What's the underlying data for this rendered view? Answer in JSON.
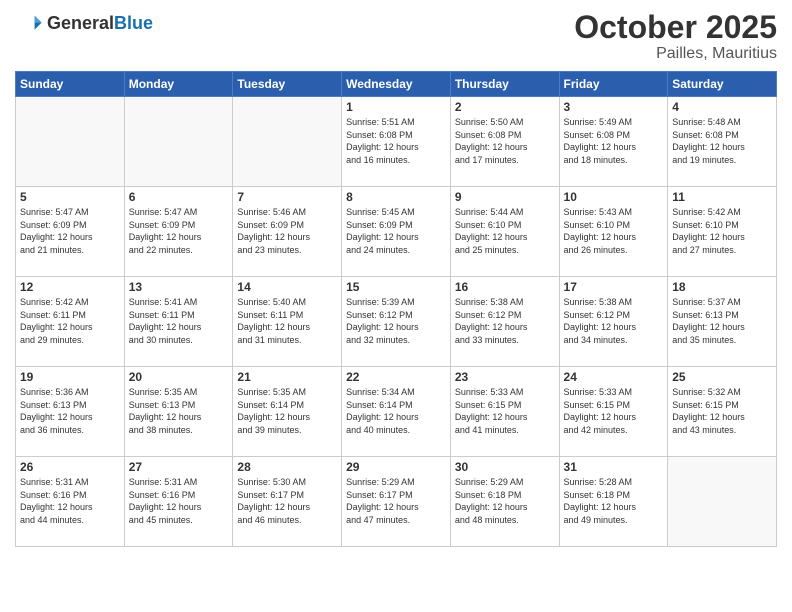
{
  "header": {
    "logo_general": "General",
    "logo_blue": "Blue",
    "month": "October 2025",
    "location": "Pailles, Mauritius"
  },
  "weekdays": [
    "Sunday",
    "Monday",
    "Tuesday",
    "Wednesday",
    "Thursday",
    "Friday",
    "Saturday"
  ],
  "weeks": [
    [
      {
        "day": "",
        "info": ""
      },
      {
        "day": "",
        "info": ""
      },
      {
        "day": "",
        "info": ""
      },
      {
        "day": "1",
        "info": "Sunrise: 5:51 AM\nSunset: 6:08 PM\nDaylight: 12 hours\nand 16 minutes."
      },
      {
        "day": "2",
        "info": "Sunrise: 5:50 AM\nSunset: 6:08 PM\nDaylight: 12 hours\nand 17 minutes."
      },
      {
        "day": "3",
        "info": "Sunrise: 5:49 AM\nSunset: 6:08 PM\nDaylight: 12 hours\nand 18 minutes."
      },
      {
        "day": "4",
        "info": "Sunrise: 5:48 AM\nSunset: 6:08 PM\nDaylight: 12 hours\nand 19 minutes."
      }
    ],
    [
      {
        "day": "5",
        "info": "Sunrise: 5:47 AM\nSunset: 6:09 PM\nDaylight: 12 hours\nand 21 minutes."
      },
      {
        "day": "6",
        "info": "Sunrise: 5:47 AM\nSunset: 6:09 PM\nDaylight: 12 hours\nand 22 minutes."
      },
      {
        "day": "7",
        "info": "Sunrise: 5:46 AM\nSunset: 6:09 PM\nDaylight: 12 hours\nand 23 minutes."
      },
      {
        "day": "8",
        "info": "Sunrise: 5:45 AM\nSunset: 6:09 PM\nDaylight: 12 hours\nand 24 minutes."
      },
      {
        "day": "9",
        "info": "Sunrise: 5:44 AM\nSunset: 6:10 PM\nDaylight: 12 hours\nand 25 minutes."
      },
      {
        "day": "10",
        "info": "Sunrise: 5:43 AM\nSunset: 6:10 PM\nDaylight: 12 hours\nand 26 minutes."
      },
      {
        "day": "11",
        "info": "Sunrise: 5:42 AM\nSunset: 6:10 PM\nDaylight: 12 hours\nand 27 minutes."
      }
    ],
    [
      {
        "day": "12",
        "info": "Sunrise: 5:42 AM\nSunset: 6:11 PM\nDaylight: 12 hours\nand 29 minutes."
      },
      {
        "day": "13",
        "info": "Sunrise: 5:41 AM\nSunset: 6:11 PM\nDaylight: 12 hours\nand 30 minutes."
      },
      {
        "day": "14",
        "info": "Sunrise: 5:40 AM\nSunset: 6:11 PM\nDaylight: 12 hours\nand 31 minutes."
      },
      {
        "day": "15",
        "info": "Sunrise: 5:39 AM\nSunset: 6:12 PM\nDaylight: 12 hours\nand 32 minutes."
      },
      {
        "day": "16",
        "info": "Sunrise: 5:38 AM\nSunset: 6:12 PM\nDaylight: 12 hours\nand 33 minutes."
      },
      {
        "day": "17",
        "info": "Sunrise: 5:38 AM\nSunset: 6:12 PM\nDaylight: 12 hours\nand 34 minutes."
      },
      {
        "day": "18",
        "info": "Sunrise: 5:37 AM\nSunset: 6:13 PM\nDaylight: 12 hours\nand 35 minutes."
      }
    ],
    [
      {
        "day": "19",
        "info": "Sunrise: 5:36 AM\nSunset: 6:13 PM\nDaylight: 12 hours\nand 36 minutes."
      },
      {
        "day": "20",
        "info": "Sunrise: 5:35 AM\nSunset: 6:13 PM\nDaylight: 12 hours\nand 38 minutes."
      },
      {
        "day": "21",
        "info": "Sunrise: 5:35 AM\nSunset: 6:14 PM\nDaylight: 12 hours\nand 39 minutes."
      },
      {
        "day": "22",
        "info": "Sunrise: 5:34 AM\nSunset: 6:14 PM\nDaylight: 12 hours\nand 40 minutes."
      },
      {
        "day": "23",
        "info": "Sunrise: 5:33 AM\nSunset: 6:15 PM\nDaylight: 12 hours\nand 41 minutes."
      },
      {
        "day": "24",
        "info": "Sunrise: 5:33 AM\nSunset: 6:15 PM\nDaylight: 12 hours\nand 42 minutes."
      },
      {
        "day": "25",
        "info": "Sunrise: 5:32 AM\nSunset: 6:15 PM\nDaylight: 12 hours\nand 43 minutes."
      }
    ],
    [
      {
        "day": "26",
        "info": "Sunrise: 5:31 AM\nSunset: 6:16 PM\nDaylight: 12 hours\nand 44 minutes."
      },
      {
        "day": "27",
        "info": "Sunrise: 5:31 AM\nSunset: 6:16 PM\nDaylight: 12 hours\nand 45 minutes."
      },
      {
        "day": "28",
        "info": "Sunrise: 5:30 AM\nSunset: 6:17 PM\nDaylight: 12 hours\nand 46 minutes."
      },
      {
        "day": "29",
        "info": "Sunrise: 5:29 AM\nSunset: 6:17 PM\nDaylight: 12 hours\nand 47 minutes."
      },
      {
        "day": "30",
        "info": "Sunrise: 5:29 AM\nSunset: 6:18 PM\nDaylight: 12 hours\nand 48 minutes."
      },
      {
        "day": "31",
        "info": "Sunrise: 5:28 AM\nSunset: 6:18 PM\nDaylight: 12 hours\nand 49 minutes."
      },
      {
        "day": "",
        "info": ""
      }
    ]
  ]
}
